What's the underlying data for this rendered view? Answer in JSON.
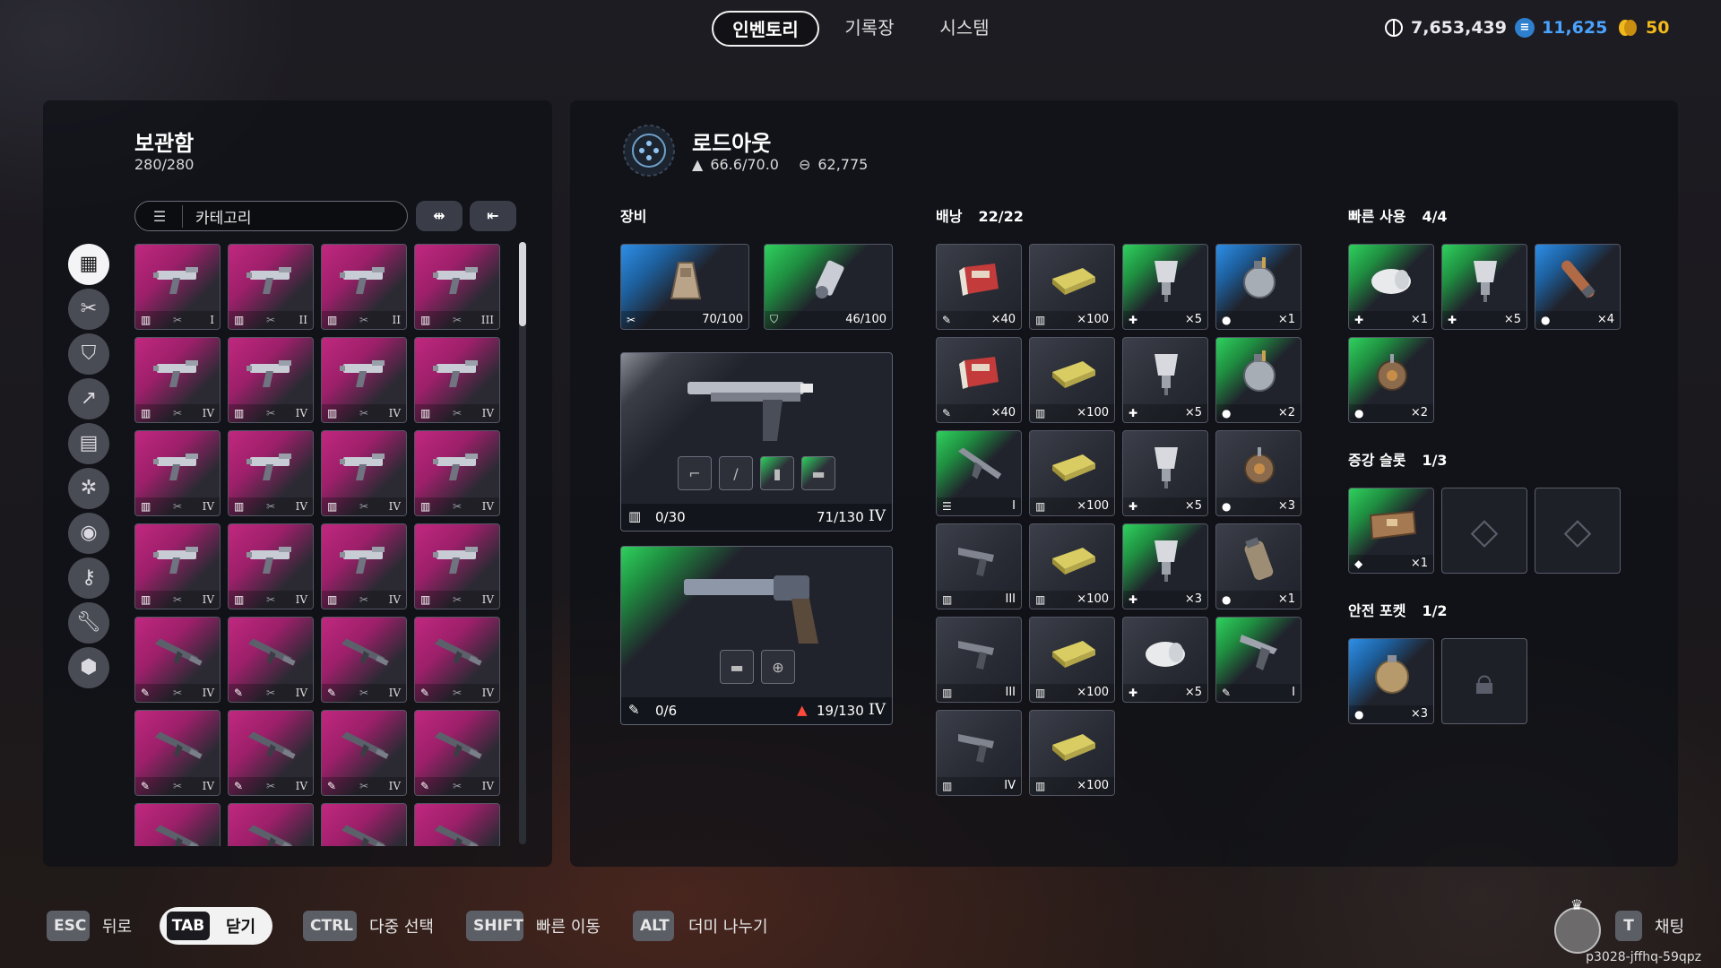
{
  "top_tabs": [
    "인벤토리",
    "기록장",
    "시스템"
  ],
  "currency": {
    "coins": "7,653,439",
    "blue": "11,625",
    "gold": "50",
    "colors": {
      "blue": "#4aa3ff",
      "gold": "#f2b91c"
    }
  },
  "stash": {
    "title": "보관함",
    "capacity": "280/280",
    "category_label": "카테고리",
    "sort_icon": "double-arrow-icon",
    "transfer_icon": "move-left-icon",
    "side_icons": [
      "grid-icon",
      "attachment-icon",
      "shield-icon",
      "ammo-icon",
      "book-icon",
      "gear-cog-icon",
      "ring-icon",
      "key-icon",
      "wrench-icon",
      "box-icon"
    ],
    "rows": [
      [
        "I",
        "II",
        "II",
        "III"
      ],
      [
        "IV",
        "IV",
        "IV",
        "IV"
      ],
      [
        "IV",
        "IV",
        "IV",
        "IV"
      ],
      [
        "IV",
        "IV",
        "IV",
        "IV"
      ],
      [
        "IV",
        "IV",
        "IV",
        "IV"
      ],
      [
        "IV",
        "IV",
        "IV",
        "IV"
      ],
      [
        "",
        "",
        "",
        ""
      ]
    ]
  },
  "loadout": {
    "title": "로드아웃",
    "weight": "66.6/70.0",
    "value": "62,775",
    "equipment_label": "장비",
    "augment_durability": "70/100",
    "shield_durability": "46/100",
    "weapon1": {
      "ammo": "0/30",
      "durability": "71/130",
      "tier": "IV"
    },
    "weapon2": {
      "ammo": "0/6",
      "durability": "19/130",
      "tier": "IV"
    }
  },
  "backpack": {
    "label": "배낭",
    "count": "22/22",
    "items": [
      {
        "type": "ammo-box",
        "color": "grey",
        "icon": "pen",
        "count": "×40"
      },
      {
        "type": "ammo-gold",
        "color": "grey",
        "icon": "bars",
        "count": "×100"
      },
      {
        "type": "injector",
        "color": "green",
        "icon": "plus",
        "count": "×5"
      },
      {
        "type": "grenade",
        "color": "blue",
        "icon": "pill",
        "count": "×1"
      },
      {
        "type": "ammo-box",
        "color": "grey",
        "icon": "pen",
        "count": "×40"
      },
      {
        "type": "ammo-gold",
        "color": "grey",
        "icon": "bars",
        "count": "×100"
      },
      {
        "type": "injector",
        "color": "grey",
        "icon": "plus",
        "count": "×5"
      },
      {
        "type": "grenade",
        "color": "green",
        "icon": "pill",
        "count": "×2"
      },
      {
        "type": "rifle",
        "color": "green",
        "icon": "list",
        "count": "I"
      },
      {
        "type": "ammo-gold",
        "color": "grey",
        "icon": "bars",
        "count": "×100"
      },
      {
        "type": "injector",
        "color": "grey",
        "icon": "plus",
        "count": "×5"
      },
      {
        "type": "mine",
        "color": "grey",
        "icon": "pill",
        "count": "×3"
      },
      {
        "type": "smg",
        "color": "grey",
        "icon": "bars",
        "count": "III"
      },
      {
        "type": "ammo-gold",
        "color": "grey",
        "icon": "bars",
        "count": "×100"
      },
      {
        "type": "injector",
        "color": "green",
        "icon": "plus",
        "count": "×3"
      },
      {
        "type": "canister",
        "color": "grey",
        "icon": "pill",
        "count": "×1"
      },
      {
        "type": "smg",
        "color": "grey",
        "icon": "bars",
        "count": "III"
      },
      {
        "type": "ammo-gold",
        "color": "grey",
        "icon": "bars",
        "count": "×100"
      },
      {
        "type": "bandage",
        "color": "grey",
        "icon": "plus",
        "count": "×5"
      },
      {
        "type": "pistol",
        "color": "green",
        "icon": "pen",
        "count": "I"
      },
      {
        "type": "smg",
        "color": "grey",
        "icon": "bars",
        "count": "IV"
      },
      {
        "type": "ammo-gold",
        "color": "grey",
        "icon": "bars",
        "count": "×100"
      }
    ]
  },
  "quick_use": {
    "label": "빠른 사용",
    "count": "4/4",
    "items": [
      {
        "type": "bandage",
        "color": "green",
        "icon": "plus",
        "count": "×1"
      },
      {
        "type": "injector",
        "color": "green",
        "icon": "plus",
        "count": "×5"
      },
      {
        "type": "flare",
        "color": "blue",
        "icon": "pill",
        "count": "×4"
      },
      {
        "type": "mine",
        "color": "green",
        "icon": "pill",
        "count": "×2"
      }
    ]
  },
  "augment": {
    "label": "증강 슬롯",
    "count": "1/3",
    "item_count": "×1"
  },
  "safe_pocket": {
    "label": "안전 포켓",
    "count": "1/2",
    "item_count": "×3"
  },
  "bottom_bar": {
    "esc_key": "ESC",
    "esc_label": "뒤로",
    "tab_key": "TAB",
    "tab_label": "닫기",
    "ctrl_key": "CTRL",
    "ctrl_label": "다중 선택",
    "shift_key": "SHIFT",
    "shift_label": "빠른 이동",
    "alt_key": "ALT",
    "alt_label": "더미 나누기",
    "chat_key": "T",
    "chat_label": "채팅",
    "user_id": "p3028-jffhq-59qpz"
  }
}
